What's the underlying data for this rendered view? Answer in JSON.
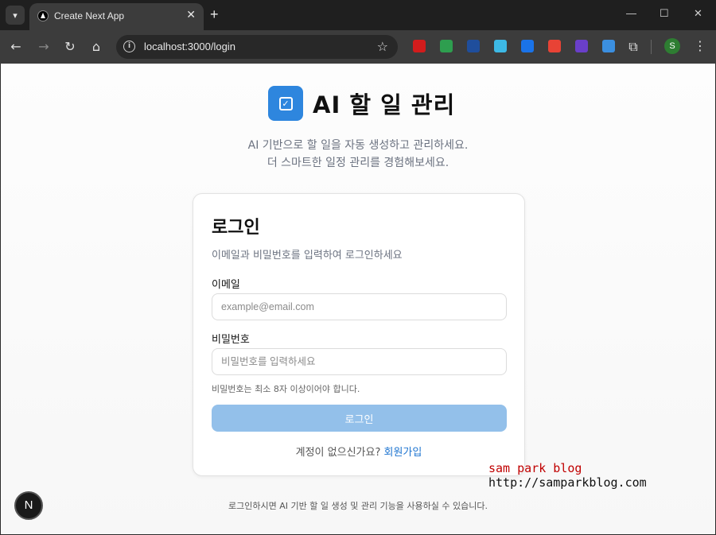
{
  "browser": {
    "tab_title": "Create Next App",
    "url": "localhost:3000/login",
    "profile_initial": "S",
    "extensions": [
      {
        "name": "red-hand-extension-icon",
        "color": "#d21c1c"
      },
      {
        "name": "green-card-extension-icon",
        "color": "#2e9e4f"
      },
      {
        "name": "check-shield-extension-icon",
        "color": "#1f4e9c"
      },
      {
        "name": "react-devtools-extension-icon",
        "color": "#3db9e5"
      },
      {
        "name": "blue-shield-extension-icon",
        "color": "#1a73e8"
      },
      {
        "name": "chrome-style-extension-icon",
        "color": "#e84335"
      },
      {
        "name": "purple-extension-icon",
        "color": "#6a3fc9"
      },
      {
        "name": "arrow-extension-icon",
        "color": "#3b8fe0"
      }
    ]
  },
  "header": {
    "title": "AI 할 일 관리",
    "subtitle_line1": "AI 기반으로 할 일을 자동 생성하고 관리하세요.",
    "subtitle_line2": "더 스마트한 일정 관리를 경험해보세요."
  },
  "login": {
    "title": "로그인",
    "description": "이메일과 비밀번호를 입력하여 로그인하세요",
    "email_label": "이메일",
    "email_placeholder": "example@email.com",
    "password_label": "비밀번호",
    "password_placeholder": "비밀번호를 입력하세요",
    "password_hint": "비밀번호는 최소 8자 이상이어야 합니다.",
    "submit_label": "로그인",
    "no_account_text": "계정이 없으신가요?",
    "signup_link": "회원가입"
  },
  "footer": {
    "text": "로그인하시면 AI 기반 할 일 생성 및 관리 기능을 사용하실 수 있습니다."
  },
  "next_badge": "N",
  "watermark": {
    "line1": "sam park blog",
    "line2": "http://samparkblog.com"
  },
  "colors": {
    "accent": "#2e86de",
    "button_disabled": "#93c0ea",
    "link": "#1d74d0"
  }
}
